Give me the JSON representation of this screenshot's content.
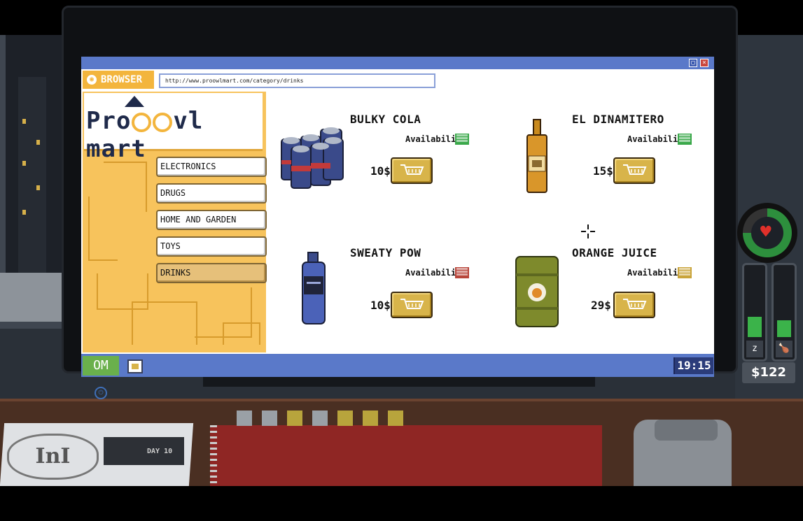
{
  "browser": {
    "tab_label": "BROWSER",
    "tab_icon": "owl-icon",
    "url": "http://www.proowlmart.com/category/drinks"
  },
  "store": {
    "logo_parts": [
      "Pro",
      "vl mart"
    ],
    "categories": [
      {
        "label": "ELECTRONICS",
        "active": false
      },
      {
        "label": "DRUGS",
        "active": false
      },
      {
        "label": "HOME AND GARDEN",
        "active": false
      },
      {
        "label": "TOYS",
        "active": false
      },
      {
        "label": "DRINKS",
        "active": true
      }
    ]
  },
  "products": [
    {
      "name": "BULKY COLA",
      "availability_label": "Availability",
      "availability_color": "#3aa84a",
      "price": "10$",
      "image": "cola-cans-image"
    },
    {
      "name": "EL DINAMITERO",
      "availability_label": "Availability",
      "availability_color": "#3aa84a",
      "price": "15$",
      "image": "liquor-bottle-image"
    },
    {
      "name": "SWEATY POW",
      "availability_label": "Availability",
      "availability_color": "#b8453a",
      "price": "10$",
      "image": "sports-drink-image"
    },
    {
      "name": "ORANGE JUICE",
      "availability_label": "Availability",
      "availability_color": "#c9a43a",
      "price": "29$",
      "image": "juice-barrel-image"
    }
  ],
  "taskbar": {
    "start_label": "OM",
    "clock": "19:15"
  },
  "hud": {
    "health_fraction": 0.75,
    "sleep_fraction": 0.3,
    "hunger_fraction": 0.25,
    "money": "$122"
  },
  "desk": {
    "day_label": "DAY 10",
    "badge_label": "InI",
    "palette_keys": [
      "#9aa0a6",
      "#9aa0a6",
      "#b8a43c",
      "#9aa0a6",
      "#b8a43c",
      "#b8a43c",
      "#b8a43c"
    ]
  },
  "colors": {
    "accent_orange": "#f3b53d",
    "titlebar_blue": "#5a79c9",
    "cart_gold": "#d8b44a",
    "start_green": "#6ab04c"
  }
}
